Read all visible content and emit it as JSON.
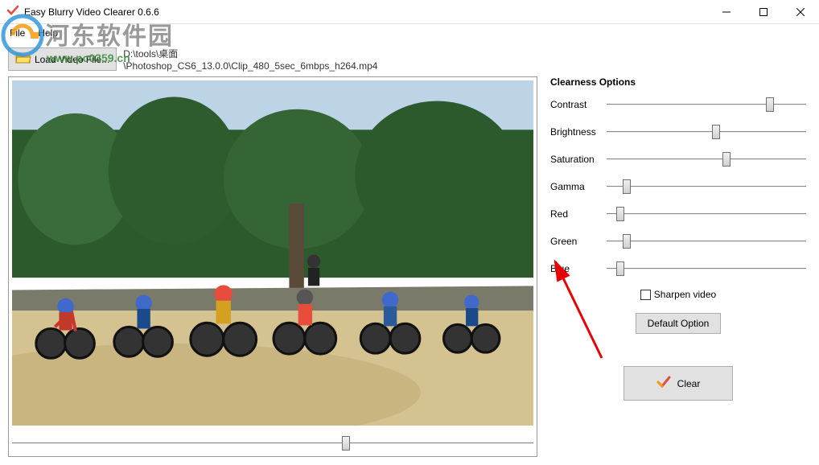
{
  "window": {
    "title": "Easy Blurry Video Clearer 0.6.6"
  },
  "menu": {
    "file": "File",
    "help": "Help"
  },
  "toolbar": {
    "load_label": "Load Video File...",
    "path_line1": "D:\\tools\\桌面",
    "path_line2": "\\Photoshop_CS6_13.0.0\\Clip_480_5sec_6mbps_h264.mp4"
  },
  "timeline": {
    "position_pct": 64
  },
  "options": {
    "title": "Clearness Options",
    "sliders": [
      {
        "label": "Contrast",
        "value_pct": 82
      },
      {
        "label": "Brightness",
        "value_pct": 55
      },
      {
        "label": "Saturation",
        "value_pct": 60
      },
      {
        "label": "Gamma",
        "value_pct": 10
      },
      {
        "label": "Red",
        "value_pct": 7
      },
      {
        "label": "Green",
        "value_pct": 10
      },
      {
        "label": "Blue",
        "value_pct": 7
      }
    ],
    "sharpen_label": "Sharpen video",
    "sharpen_checked": false,
    "default_label": "Default Option",
    "clear_label": "Clear"
  },
  "watermark": {
    "text": "河东软件园",
    "url": "www.pc0359.cn"
  }
}
